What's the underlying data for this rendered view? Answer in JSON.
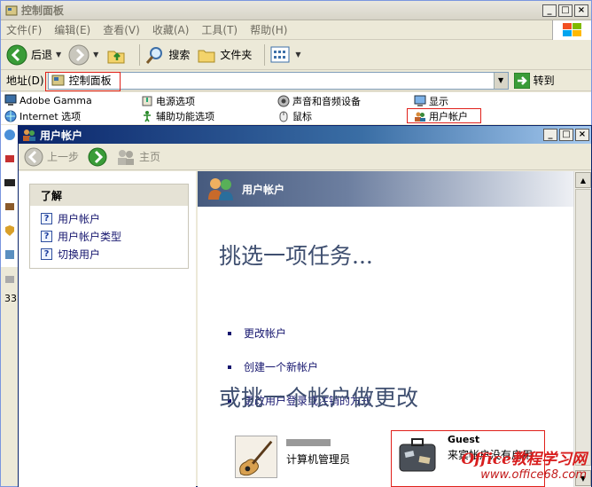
{
  "outer": {
    "title": "控制面板",
    "menu": [
      "文件(F)",
      "编辑(E)",
      "查看(V)",
      "收藏(A)",
      "工具(T)",
      "帮助(H)"
    ],
    "toolbar": {
      "back": "后退",
      "search": "搜索",
      "folders": "文件夹"
    },
    "address": {
      "label": "地址(D)",
      "value": "控制面板",
      "go": "转到"
    },
    "items": [
      {
        "label": "Adobe Gamma",
        "icon": "monitor-icon"
      },
      {
        "label": "电源选项",
        "icon": "power-icon"
      },
      {
        "label": "声音和音频设备",
        "icon": "speaker-icon"
      },
      {
        "label": "显示",
        "icon": "display-icon"
      },
      {
        "label": "Internet 选项",
        "icon": "globe-icon"
      },
      {
        "label": "辅助功能选项",
        "icon": "accessibility-icon"
      },
      {
        "label": "鼠标",
        "icon": "mouse-icon"
      },
      {
        "label": "用户帐户",
        "icon": "users-icon"
      }
    ],
    "status_count": "33"
  },
  "inner": {
    "title": "用户帐户",
    "nav": {
      "back": "上一步",
      "home": "主页"
    },
    "learn": {
      "heading": "了解",
      "links": [
        "用户帐户",
        "用户帐户类型",
        "切换用户"
      ]
    },
    "header": "用户帐户",
    "pick_title": "挑选一项任务...",
    "tasks": [
      "更改帐户",
      "创建一个新帐户",
      "更改用户登录或注销的方式"
    ],
    "or_title": "或挑一个帐户做更改",
    "accounts": [
      {
        "name": "",
        "role": "计算机管理员"
      },
      {
        "name": "Guest",
        "role": "来宾帐户没有启用"
      }
    ]
  },
  "watermark": {
    "brand": "Office教程学习网",
    "url": "www.office68.com"
  },
  "colors": {
    "highlight": "#e0201a",
    "link": "#15156e",
    "heading": "#3f4f70"
  }
}
